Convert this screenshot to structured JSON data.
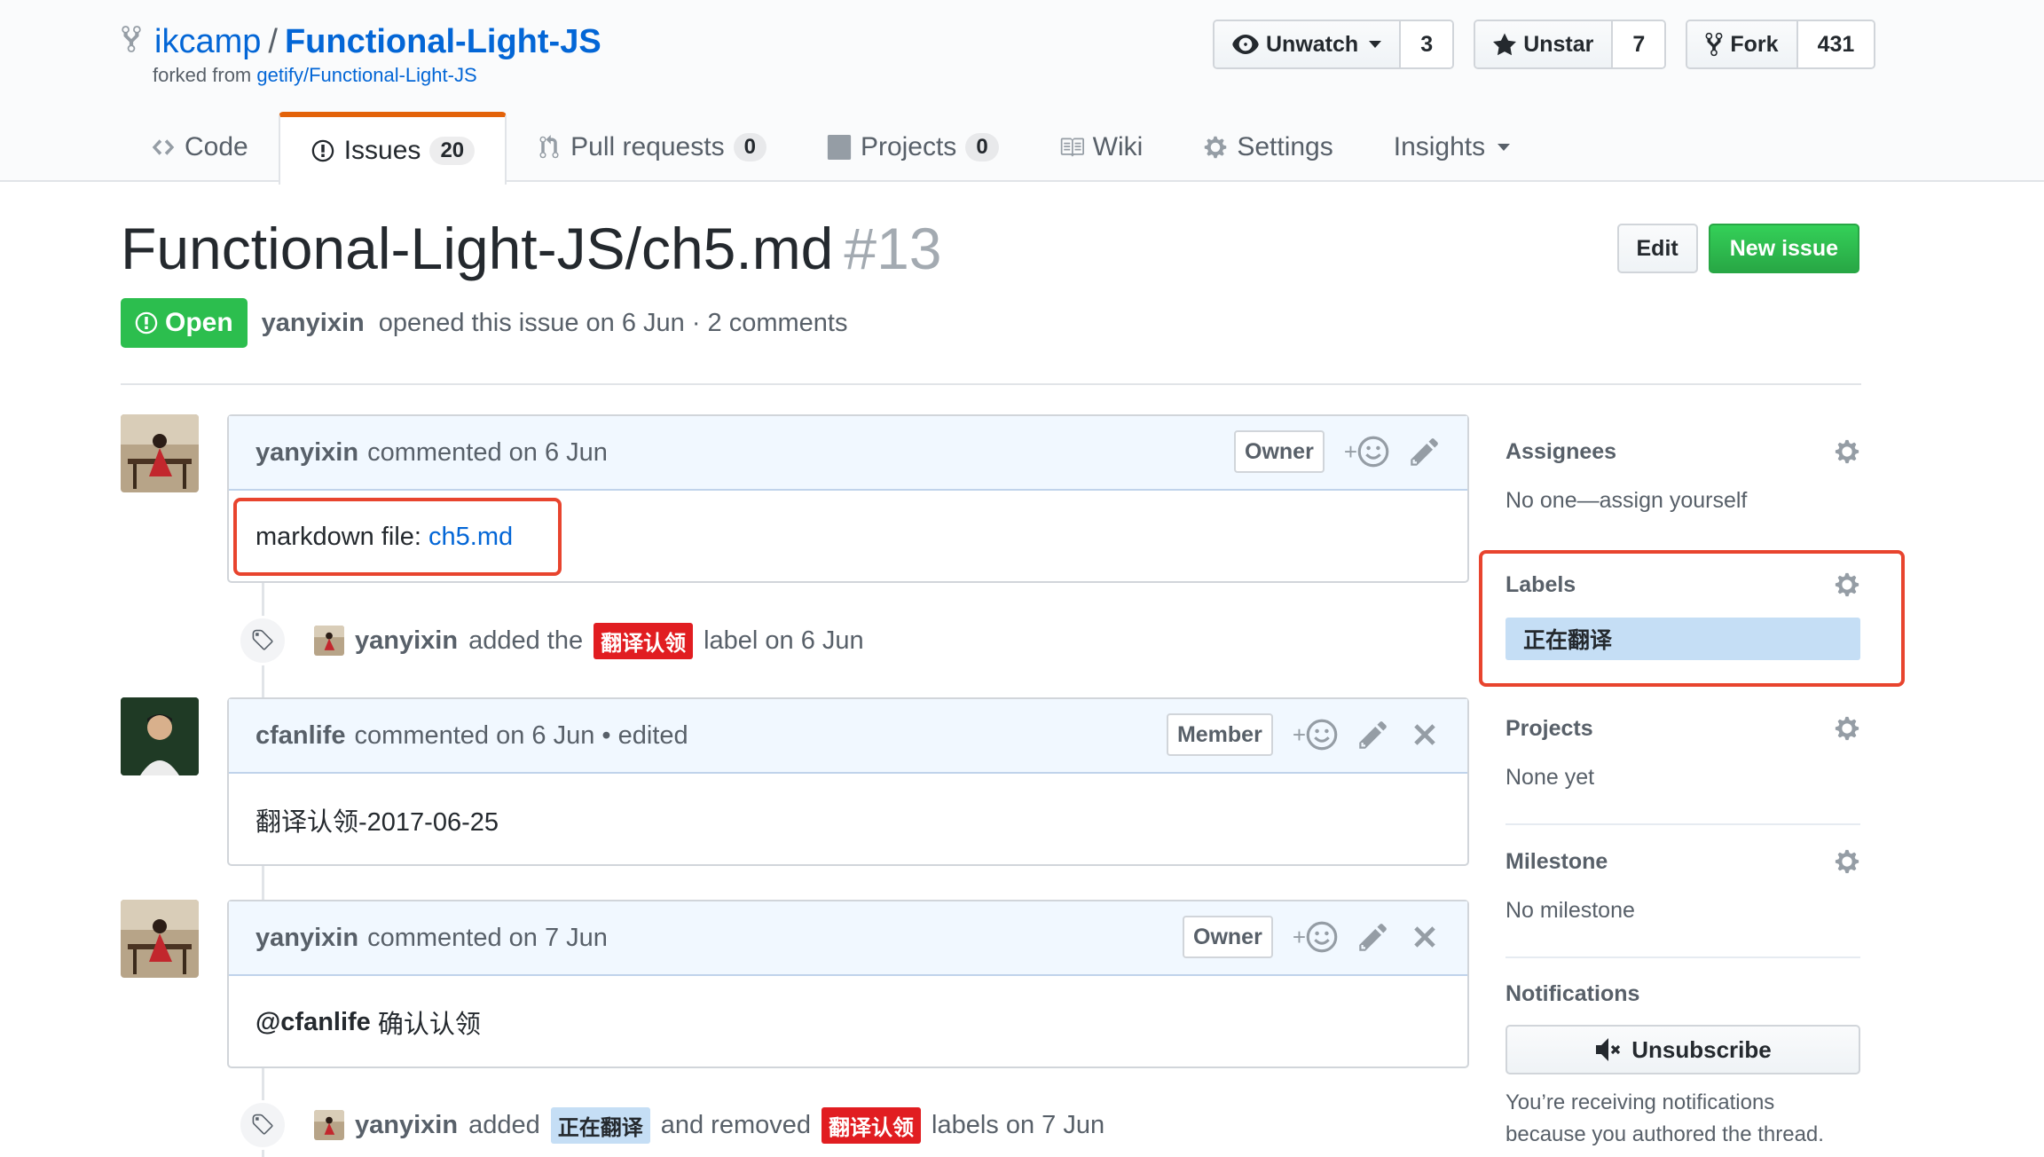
{
  "repo": {
    "owner": "ikcamp",
    "separator": "/",
    "name": "Functional-Light-JS",
    "forked_prefix": "forked from",
    "forked_source": "getify/Functional-Light-JS"
  },
  "actions": {
    "watch_label": "Unwatch",
    "watch_count": "3",
    "star_label": "Unstar",
    "star_count": "7",
    "fork_label": "Fork",
    "fork_count": "431"
  },
  "nav": {
    "code": "Code",
    "issues": "Issues",
    "issues_count": "20",
    "pulls": "Pull requests",
    "pulls_count": "0",
    "projects": "Projects",
    "projects_count": "0",
    "wiki": "Wiki",
    "settings": "Settings",
    "insights": "Insights"
  },
  "issue": {
    "title": "Functional-Light-JS/ch5.md",
    "number": "#13",
    "edit_label": "Edit",
    "new_label": "New issue",
    "state": "Open",
    "author": "yanyixin",
    "meta_text": "opened this issue on 6 Jun · 2 comments"
  },
  "timeline": {
    "c1_author": "yanyixin",
    "c1_meta": "commented on 6 Jun",
    "c1_role": "Owner",
    "c1_body_prefix": "markdown file:",
    "c1_body_link": "ch5.md",
    "e1_actor": "yanyixin",
    "e1_text1": "added the",
    "e1_label": "翻译认领",
    "e1_text2": "label on 6 Jun",
    "c2_author": "cfanlife",
    "c2_meta": "commented on 6 Jun • edited",
    "c2_role": "Member",
    "c2_body": "翻译认领-2017-06-25",
    "c3_author": "yanyixin",
    "c3_meta": "commented on 7 Jun",
    "c3_role": "Owner",
    "c3_body_mention": "@cfanlife",
    "c3_body_text": "确认认领",
    "e2_actor": "yanyixin",
    "e2_text1": "added",
    "e2_label_added": "正在翻译",
    "e2_text2": "and removed",
    "e2_label_removed": "翻译认领",
    "e2_text3": "labels on 7 Jun",
    "emoji_plus": "+"
  },
  "sidebar": {
    "assignees_title": "Assignees",
    "assignees_value": "No one—assign yourself",
    "labels_title": "Labels",
    "labels_value": "正在翻译",
    "projects_title": "Projects",
    "projects_value": "None yet",
    "milestone_title": "Milestone",
    "milestone_value": "No milestone",
    "notifications_title": "Notifications",
    "unsubscribe_label": "Unsubscribe",
    "notifications_text": "You’re receiving notifications because you authored the thread."
  },
  "colors": {
    "link": "#0366d6",
    "open_green": "#2cbe4e",
    "new_issue_green": "#28a745",
    "label_red": "#e11d21",
    "label_blue": "#c5def5",
    "highlight": "#e8442e",
    "tab_accent": "#e36209"
  }
}
